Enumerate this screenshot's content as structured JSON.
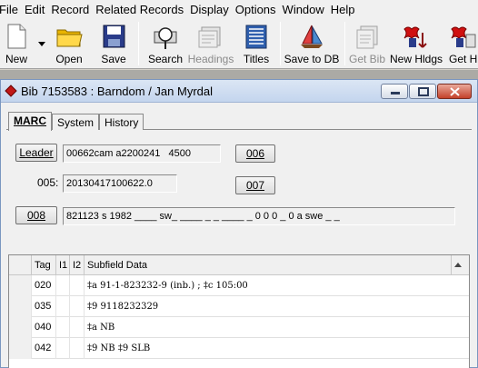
{
  "menu": [
    "File",
    "Edit",
    "Record",
    "Related Records",
    "Display",
    "Options",
    "Window",
    "Help"
  ],
  "toolbar": {
    "new": "New",
    "open": "Open",
    "save": "Save",
    "search": "Search",
    "headings": "Headings",
    "titles": "Titles",
    "save_to_db": "Save to DB",
    "get_bib": "Get Bib",
    "new_hldgs": "New Hldgs",
    "get_hldgs": "Get Hldgs"
  },
  "window": {
    "title": "Bib 7153583 : Barndom / Jan Myrdal"
  },
  "tabs": [
    "MARC",
    "System",
    "History"
  ],
  "marc": {
    "leader_button": "Leader",
    "leader_value": "00662cam a2200241   4500",
    "btn_006": "006",
    "label_005": "005:",
    "value_005": "20130417100622.0",
    "btn_007": "007",
    "btn_008": "008",
    "value_008": "821123 s 1982 ____ sw_ ____ _ _ ____ _ 0 0 0 _ 0 a swe _ _"
  },
  "grid": {
    "headers": [
      "Tag",
      "I1",
      "I2",
      "Subfield Data"
    ],
    "rows": [
      {
        "tag": "020",
        "i1": "",
        "i2": "",
        "data": "‡a 91-1-823232-9 (inb.) ; ‡c 105:00"
      },
      {
        "tag": "035",
        "i1": "",
        "i2": "",
        "data": "‡9 9118232329"
      },
      {
        "tag": "040",
        "i1": "",
        "i2": "",
        "data": "‡a NB"
      },
      {
        "tag": "042",
        "i1": "",
        "i2": "",
        "data": "‡9 NB ‡9 SLB"
      }
    ]
  }
}
